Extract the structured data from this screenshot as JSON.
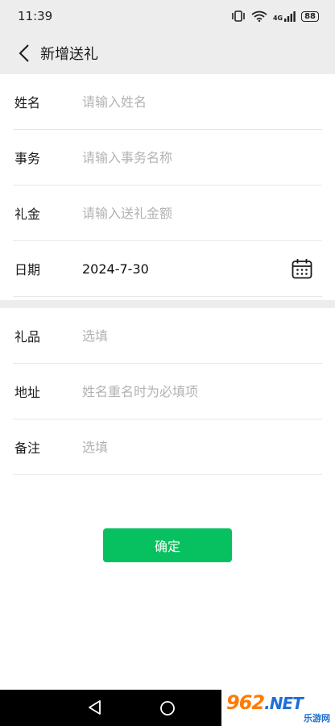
{
  "status_bar": {
    "time": "11:39",
    "network_label": "4G",
    "battery": "88"
  },
  "header": {
    "title": "新增送礼"
  },
  "form": {
    "name_label": "姓名",
    "name_placeholder": "请输入姓名",
    "matter_label": "事务",
    "matter_placeholder": "请输入事务名称",
    "money_label": "礼金",
    "money_placeholder": "请输入送礼金额",
    "date_label": "日期",
    "date_value": "2024-7-30",
    "gift_label": "礼品",
    "gift_placeholder": "选填",
    "address_label": "地址",
    "address_placeholder": "姓名重名时为必填项",
    "remark_label": "备注",
    "remark_placeholder": "选填"
  },
  "actions": {
    "confirm_label": "确定"
  },
  "colors": {
    "accent": "#07c160",
    "header_bg": "#ededed"
  },
  "watermark": {
    "logo": "962",
    "logo_suffix": ".NET",
    "sub": "乐游网"
  }
}
